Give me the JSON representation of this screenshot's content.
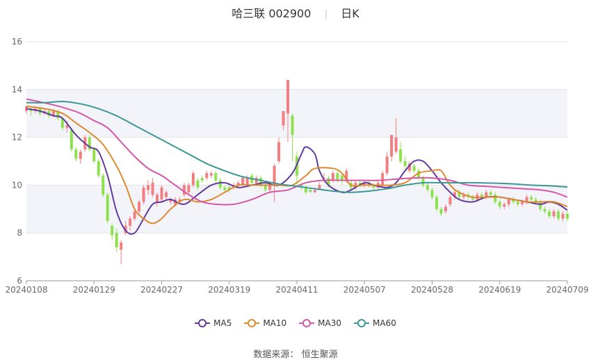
{
  "header": {
    "stock_name": "哈三联",
    "stock_code": "002900",
    "period": "日K"
  },
  "footer": {
    "source_label": "数据来源：",
    "source_name": "恒生聚源"
  },
  "colors": {
    "up": "#f17f80",
    "down": "#8fe04e",
    "MA5": "#62399c",
    "MA10": "#dd8a2f",
    "MA30": "#d457a7",
    "MA60": "#3c9696",
    "band": "#f2f4fa",
    "grid": "#e3e3e3"
  },
  "chart_data": {
    "type": "candlestick",
    "ylim": [
      6,
      16
    ],
    "yticks": [
      6,
      8,
      10,
      12,
      14,
      16
    ],
    "xticks": [
      "20240108",
      "20240129",
      "20240227",
      "20240319",
      "20240411",
      "20240507",
      "20240528",
      "20240619",
      "20240709"
    ],
    "n_days": 121,
    "xtick_index": [
      0,
      15,
      30,
      45,
      60,
      75,
      90,
      105,
      120
    ],
    "legend": [
      "MA5",
      "MA10",
      "MA30",
      "MA60"
    ],
    "candles": [
      [
        13.1,
        13.3,
        13.3,
        13.0
      ],
      [
        13.2,
        13.1,
        13.3,
        12.9
      ],
      [
        13.1,
        13.2,
        13.25,
        13.0
      ],
      [
        13.2,
        13.0,
        13.3,
        12.9
      ],
      [
        13.0,
        13.1,
        13.2,
        12.95
      ],
      [
        13.1,
        12.9,
        13.2,
        12.8
      ],
      [
        12.9,
        13.1,
        13.2,
        12.85
      ],
      [
        13.1,
        12.8,
        13.15,
        12.7
      ],
      [
        12.8,
        12.4,
        12.85,
        12.3
      ],
      [
        12.4,
        12.5,
        12.7,
        12.2
      ],
      [
        12.3,
        11.5,
        12.4,
        11.4
      ],
      [
        11.5,
        11.1,
        11.6,
        11.0
      ],
      [
        11.1,
        11.4,
        11.5,
        10.9
      ],
      [
        11.5,
        12.0,
        12.1,
        11.4
      ],
      [
        12.0,
        11.5,
        12.1,
        11.4
      ],
      [
        11.5,
        11.0,
        11.6,
        10.9
      ],
      [
        11.0,
        10.4,
        11.1,
        10.3
      ],
      [
        10.4,
        9.6,
        10.5,
        9.5
      ],
      [
        9.6,
        8.5,
        9.7,
        8.4
      ],
      [
        8.3,
        7.9,
        8.4,
        7.7
      ],
      [
        8.0,
        7.4,
        8.2,
        7.2
      ],
      [
        7.3,
        7.6,
        7.7,
        6.7
      ],
      [
        8.0,
        8.3,
        8.5,
        7.9
      ],
      [
        8.3,
        8.6,
        8.7,
        8.1
      ],
      [
        8.6,
        8.9,
        9.0,
        8.5
      ],
      [
        8.9,
        9.3,
        9.4,
        8.8
      ],
      [
        9.3,
        9.9,
        10.0,
        9.2
      ],
      [
        9.8,
        10.0,
        10.2,
        9.6
      ],
      [
        9.6,
        10.1,
        10.3,
        9.5
      ],
      [
        9.3,
        9.6,
        9.7,
        9.1
      ],
      [
        9.4,
        9.9,
        10.0,
        9.3
      ],
      [
        9.5,
        9.7,
        9.8,
        9.4
      ],
      [
        9.3,
        9.4,
        9.5,
        9.2
      ],
      [
        9.2,
        9.4,
        9.5,
        9.1
      ],
      [
        9.3,
        9.4,
        9.5,
        9.2
      ],
      [
        9.6,
        10.0,
        10.1,
        9.5
      ],
      [
        9.7,
        10.0,
        10.1,
        9.6
      ],
      [
        10.0,
        10.5,
        10.6,
        9.9
      ],
      [
        10.2,
        9.9,
        10.3,
        9.8
      ],
      [
        10.3,
        10.2,
        10.4,
        10.1
      ],
      [
        10.3,
        10.5,
        10.6,
        10.2
      ],
      [
        10.4,
        10.5,
        10.6,
        10.3
      ],
      [
        10.5,
        10.2,
        10.6,
        10.1
      ],
      [
        10.2,
        9.9,
        10.3,
        9.8
      ],
      [
        9.9,
        9.8,
        10.0,
        9.7
      ],
      [
        9.9,
        9.8,
        10.0,
        9.7
      ],
      [
        9.9,
        10.0,
        10.1,
        9.8
      ],
      [
        10.0,
        10.1,
        10.2,
        9.9
      ],
      [
        10.0,
        10.3,
        10.4,
        9.9
      ],
      [
        10.0,
        10.3,
        10.4,
        9.95
      ],
      [
        10.4,
        10.1,
        10.5,
        10.0
      ],
      [
        10.1,
        10.3,
        10.4,
        10.0
      ],
      [
        10.3,
        10.0,
        10.4,
        9.9
      ],
      [
        10.0,
        9.8,
        10.1,
        9.7
      ],
      [
        9.8,
        10.0,
        10.1,
        9.7
      ],
      [
        10.0,
        10.8,
        10.9,
        9.3
      ],
      [
        11.0,
        11.8,
        12.0,
        10.9
      ],
      [
        12.5,
        13.1,
        13.1,
        12.3
      ],
      [
        13.0,
        14.4,
        14.4,
        11.8
      ],
      [
        12.9,
        12.1,
        13.0,
        11.0
      ],
      [
        11.2,
        10.4,
        11.4,
        10.0
      ],
      [
        10.0,
        9.9,
        10.1,
        9.8
      ],
      [
        9.9,
        9.7,
        10.0,
        9.6
      ],
      [
        9.8,
        9.7,
        9.9,
        9.7
      ],
      [
        9.7,
        9.8,
        9.9,
        9.7
      ],
      [
        9.8,
        10.0,
        10.1,
        9.8
      ],
      [
        10.3,
        10.3,
        10.5,
        10.1
      ],
      [
        10.3,
        10.0,
        10.4,
        9.9
      ],
      [
        10.2,
        10.5,
        10.6,
        10.1
      ],
      [
        10.5,
        10.2,
        10.6,
        10.1
      ],
      [
        10.4,
        10.2,
        10.5,
        10.0
      ],
      [
        10.2,
        10.6,
        10.7,
        10.1
      ],
      [
        10.1,
        9.9,
        10.2,
        9.8
      ],
      [
        9.9,
        10.1,
        10.2,
        9.8
      ],
      [
        10.1,
        10.0,
        10.2,
        9.9
      ],
      [
        10.0,
        10.1,
        10.2,
        9.9
      ],
      [
        10.1,
        10.0,
        10.2,
        9.9
      ],
      [
        10.0,
        9.9,
        10.1,
        9.8
      ],
      [
        9.9,
        10.1,
        10.2,
        9.8
      ],
      [
        10.0,
        10.5,
        10.6,
        9.9
      ],
      [
        10.5,
        11.2,
        11.4,
        10.4
      ],
      [
        11.2,
        12.1,
        12.1,
        11.0
      ],
      [
        11.4,
        12.0,
        12.8,
        11.3
      ],
      [
        11.5,
        11.0,
        11.8,
        10.9
      ],
      [
        11.0,
        10.8,
        11.2,
        10.6
      ],
      [
        10.6,
        10.9,
        11.0,
        10.5
      ],
      [
        10.8,
        10.6,
        10.9,
        10.5
      ],
      [
        10.6,
        10.3,
        10.7,
        10.2
      ],
      [
        10.3,
        10.0,
        10.4,
        9.9
      ],
      [
        10.0,
        9.8,
        10.1,
        9.7
      ],
      [
        9.8,
        9.5,
        9.9,
        9.4
      ],
      [
        9.5,
        9.0,
        9.6,
        8.9
      ],
      [
        9.0,
        8.8,
        9.1,
        8.7
      ],
      [
        8.9,
        9.1,
        9.2,
        8.8
      ],
      [
        9.2,
        9.5,
        9.6,
        9.1
      ],
      [
        9.5,
        9.7,
        9.8,
        9.4
      ],
      [
        9.7,
        9.5,
        9.8,
        9.4
      ],
      [
        9.5,
        9.6,
        9.7,
        9.4
      ],
      [
        9.6,
        9.5,
        9.7,
        9.4
      ],
      [
        9.5,
        9.4,
        9.6,
        9.3
      ],
      [
        9.4,
        9.6,
        9.7,
        9.3
      ],
      [
        9.6,
        9.5,
        9.7,
        9.4
      ],
      [
        9.5,
        9.7,
        9.8,
        9.4
      ],
      [
        9.7,
        9.6,
        9.8,
        9.5
      ],
      [
        9.6,
        9.3,
        9.7,
        9.2
      ],
      [
        9.3,
        9.1,
        9.4,
        9.0
      ],
      [
        9.1,
        9.2,
        9.3,
        9.0
      ],
      [
        9.2,
        9.4,
        9.5,
        9.1
      ],
      [
        9.4,
        9.3,
        9.5,
        9.2
      ],
      [
        9.3,
        9.2,
        9.4,
        9.1
      ],
      [
        9.2,
        9.3,
        9.4,
        9.1
      ],
      [
        9.3,
        9.5,
        9.6,
        9.2
      ],
      [
        9.5,
        9.4,
        9.6,
        9.3
      ],
      [
        9.4,
        9.3,
        9.5,
        9.2
      ],
      [
        9.3,
        9.0,
        9.4,
        8.9
      ],
      [
        9.0,
        8.9,
        9.1,
        8.8
      ],
      [
        8.9,
        8.7,
        9.0,
        8.6
      ],
      [
        8.7,
        8.9,
        9.0,
        8.6
      ],
      [
        8.9,
        8.6,
        9.0,
        8.5
      ],
      [
        8.6,
        8.8,
        8.9,
        8.5
      ],
      [
        8.8,
        8.6,
        8.9,
        8.5
      ]
    ],
    "series": [
      {
        "name": "MA5",
        "points": [
          [
            0,
            13.2
          ],
          [
            3,
            13.1
          ],
          [
            6,
            12.9
          ],
          [
            8,
            12.8
          ],
          [
            11,
            12.1
          ],
          [
            14,
            11.6
          ],
          [
            16,
            11.4
          ],
          [
            18,
            10.4
          ],
          [
            20,
            8.9
          ],
          [
            22,
            8.1
          ],
          [
            24,
            8.0
          ],
          [
            26,
            8.6
          ],
          [
            28,
            9.2
          ],
          [
            30,
            9.3
          ],
          [
            32,
            9.4
          ],
          [
            35,
            9.2
          ],
          [
            38,
            9.6
          ],
          [
            41,
            10.0
          ],
          [
            44,
            10.1
          ],
          [
            47,
            9.9
          ],
          [
            50,
            10.0
          ],
          [
            53,
            10.1
          ],
          [
            56,
            10.0
          ],
          [
            59,
            10.5
          ],
          [
            61,
            11.3
          ],
          [
            62,
            11.6
          ],
          [
            64,
            11.3
          ],
          [
            65,
            10.6
          ],
          [
            67,
            10.0
          ],
          [
            70,
            9.7
          ],
          [
            72,
            9.8
          ],
          [
            75,
            10.1
          ],
          [
            77,
            10.0
          ],
          [
            80,
            9.9
          ],
          [
            82,
            10.1
          ],
          [
            84,
            10.6
          ],
          [
            86,
            11.0
          ],
          [
            88,
            11.0
          ],
          [
            90,
            10.6
          ],
          [
            92,
            10.1
          ],
          [
            94,
            9.7
          ],
          [
            96,
            9.4
          ],
          [
            99,
            9.3
          ],
          [
            102,
            9.5
          ],
          [
            105,
            9.5
          ],
          [
            108,
            9.4
          ],
          [
            111,
            9.3
          ],
          [
            114,
            9.2
          ],
          [
            116,
            9.3
          ],
          [
            118,
            9.2
          ],
          [
            120,
            8.95
          ]
        ]
      },
      {
        "name": "MA10",
        "points": [
          [
            0,
            13.3
          ],
          [
            4,
            13.2
          ],
          [
            8,
            13.0
          ],
          [
            11,
            12.6
          ],
          [
            14,
            12.2
          ],
          [
            17,
            11.7
          ],
          [
            20,
            10.8
          ],
          [
            22,
            10.0
          ],
          [
            24,
            9.0
          ],
          [
            26,
            8.6
          ],
          [
            28,
            8.4
          ],
          [
            30,
            8.6
          ],
          [
            32,
            9.0
          ],
          [
            35,
            9.4
          ],
          [
            38,
            9.3
          ],
          [
            41,
            9.4
          ],
          [
            44,
            9.7
          ],
          [
            47,
            10.0
          ],
          [
            50,
            10.0
          ],
          [
            53,
            10.0
          ],
          [
            56,
            10.0
          ],
          [
            59,
            10.0
          ],
          [
            62,
            10.4
          ],
          [
            64,
            10.7
          ],
          [
            68,
            10.7
          ],
          [
            70,
            10.5
          ],
          [
            72,
            10.0
          ],
          [
            75,
            10.0
          ],
          [
            78,
            10.0
          ],
          [
            81,
            10.0
          ],
          [
            84,
            10.1
          ],
          [
            87,
            10.5
          ],
          [
            90,
            10.6
          ],
          [
            92,
            10.6
          ],
          [
            94,
            10.0
          ],
          [
            96,
            9.7
          ],
          [
            99,
            9.5
          ],
          [
            102,
            9.5
          ],
          [
            105,
            9.5
          ],
          [
            108,
            9.4
          ],
          [
            111,
            9.3
          ],
          [
            114,
            9.3
          ],
          [
            117,
            9.3
          ],
          [
            120,
            9.1
          ]
        ]
      },
      {
        "name": "MA30",
        "points": [
          [
            0,
            13.6
          ],
          [
            5,
            13.4
          ],
          [
            9,
            13.2
          ],
          [
            12,
            13.0
          ],
          [
            15,
            12.7
          ],
          [
            18,
            12.4
          ],
          [
            21,
            11.8
          ],
          [
            24,
            11.2
          ],
          [
            27,
            10.7
          ],
          [
            30,
            10.4
          ],
          [
            33,
            10.0
          ],
          [
            36,
            9.6
          ],
          [
            39,
            9.3
          ],
          [
            42,
            9.2
          ],
          [
            46,
            9.2
          ],
          [
            50,
            9.4
          ],
          [
            54,
            9.7
          ],
          [
            58,
            9.8
          ],
          [
            62,
            10.1
          ],
          [
            66,
            10.2
          ],
          [
            70,
            10.2
          ],
          [
            74,
            10.2
          ],
          [
            78,
            10.2
          ],
          [
            82,
            10.25
          ],
          [
            86,
            10.3
          ],
          [
            90,
            10.3
          ],
          [
            94,
            10.2
          ],
          [
            98,
            10.0
          ],
          [
            102,
            9.95
          ],
          [
            106,
            9.9
          ],
          [
            110,
            9.85
          ],
          [
            114,
            9.8
          ],
          [
            117,
            9.7
          ],
          [
            120,
            9.5
          ]
        ]
      },
      {
        "name": "MA60",
        "points": [
          [
            0,
            13.45
          ],
          [
            4,
            13.45
          ],
          [
            8,
            13.5
          ],
          [
            12,
            13.4
          ],
          [
            16,
            13.2
          ],
          [
            20,
            12.9
          ],
          [
            24,
            12.5
          ],
          [
            28,
            12.1
          ],
          [
            32,
            11.7
          ],
          [
            36,
            11.3
          ],
          [
            40,
            10.9
          ],
          [
            44,
            10.6
          ],
          [
            48,
            10.35
          ],
          [
            52,
            10.2
          ],
          [
            56,
            10.05
          ],
          [
            60,
            9.95
          ],
          [
            64,
            9.85
          ],
          [
            68,
            9.75
          ],
          [
            72,
            9.7
          ],
          [
            76,
            9.75
          ],
          [
            80,
            9.85
          ],
          [
            84,
            10.0
          ],
          [
            88,
            10.1
          ],
          [
            92,
            10.1
          ],
          [
            96,
            10.1
          ],
          [
            100,
            10.1
          ],
          [
            104,
            10.08
          ],
          [
            108,
            10.05
          ],
          [
            112,
            10.0
          ],
          [
            116,
            9.97
          ],
          [
            120,
            9.92
          ]
        ]
      }
    ]
  }
}
